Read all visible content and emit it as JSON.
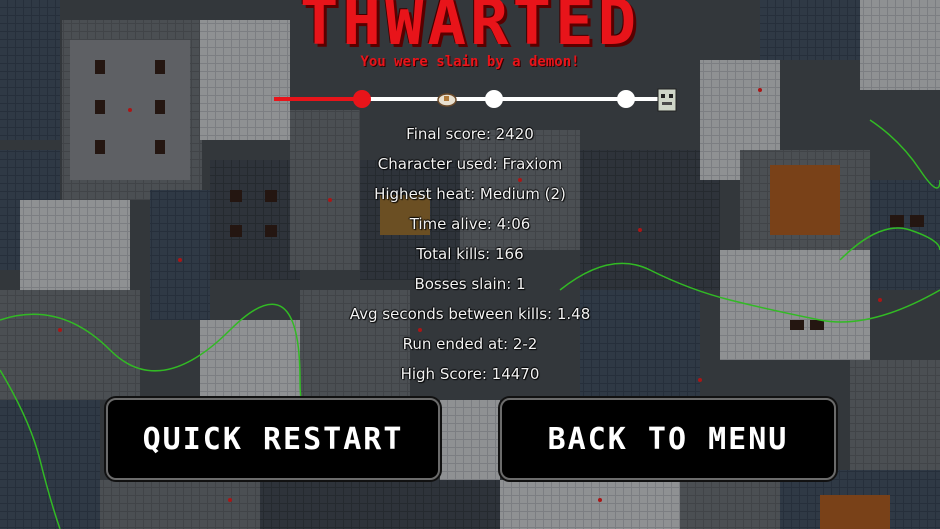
{
  "screen": {
    "title": "THWARTED",
    "cause": "You were slain by a demon!"
  },
  "run_progress": {
    "nodes_total": 4,
    "nodes_reached": 1,
    "line_color_done": "#e8141a",
    "line_color_remaining": "#ffffff"
  },
  "stats": [
    "Final score: 2420",
    "Character used: Fraxiom",
    "Highest heat: Medium (2)",
    "Time alive: 4:06",
    "Total kills: 166",
    "Bosses slain: 1",
    "Avg seconds between kills: 1.48",
    "Run ended at: 2-2",
    "High Score: 14470"
  ],
  "buttons": {
    "quick_restart": "QUICK RESTART",
    "back_to_menu": "BACK TO MENU"
  },
  "colors": {
    "title": "#e8141a",
    "text": "#f2f2f2",
    "button_bg": "#000000",
    "button_border": "#6b6b6b"
  }
}
